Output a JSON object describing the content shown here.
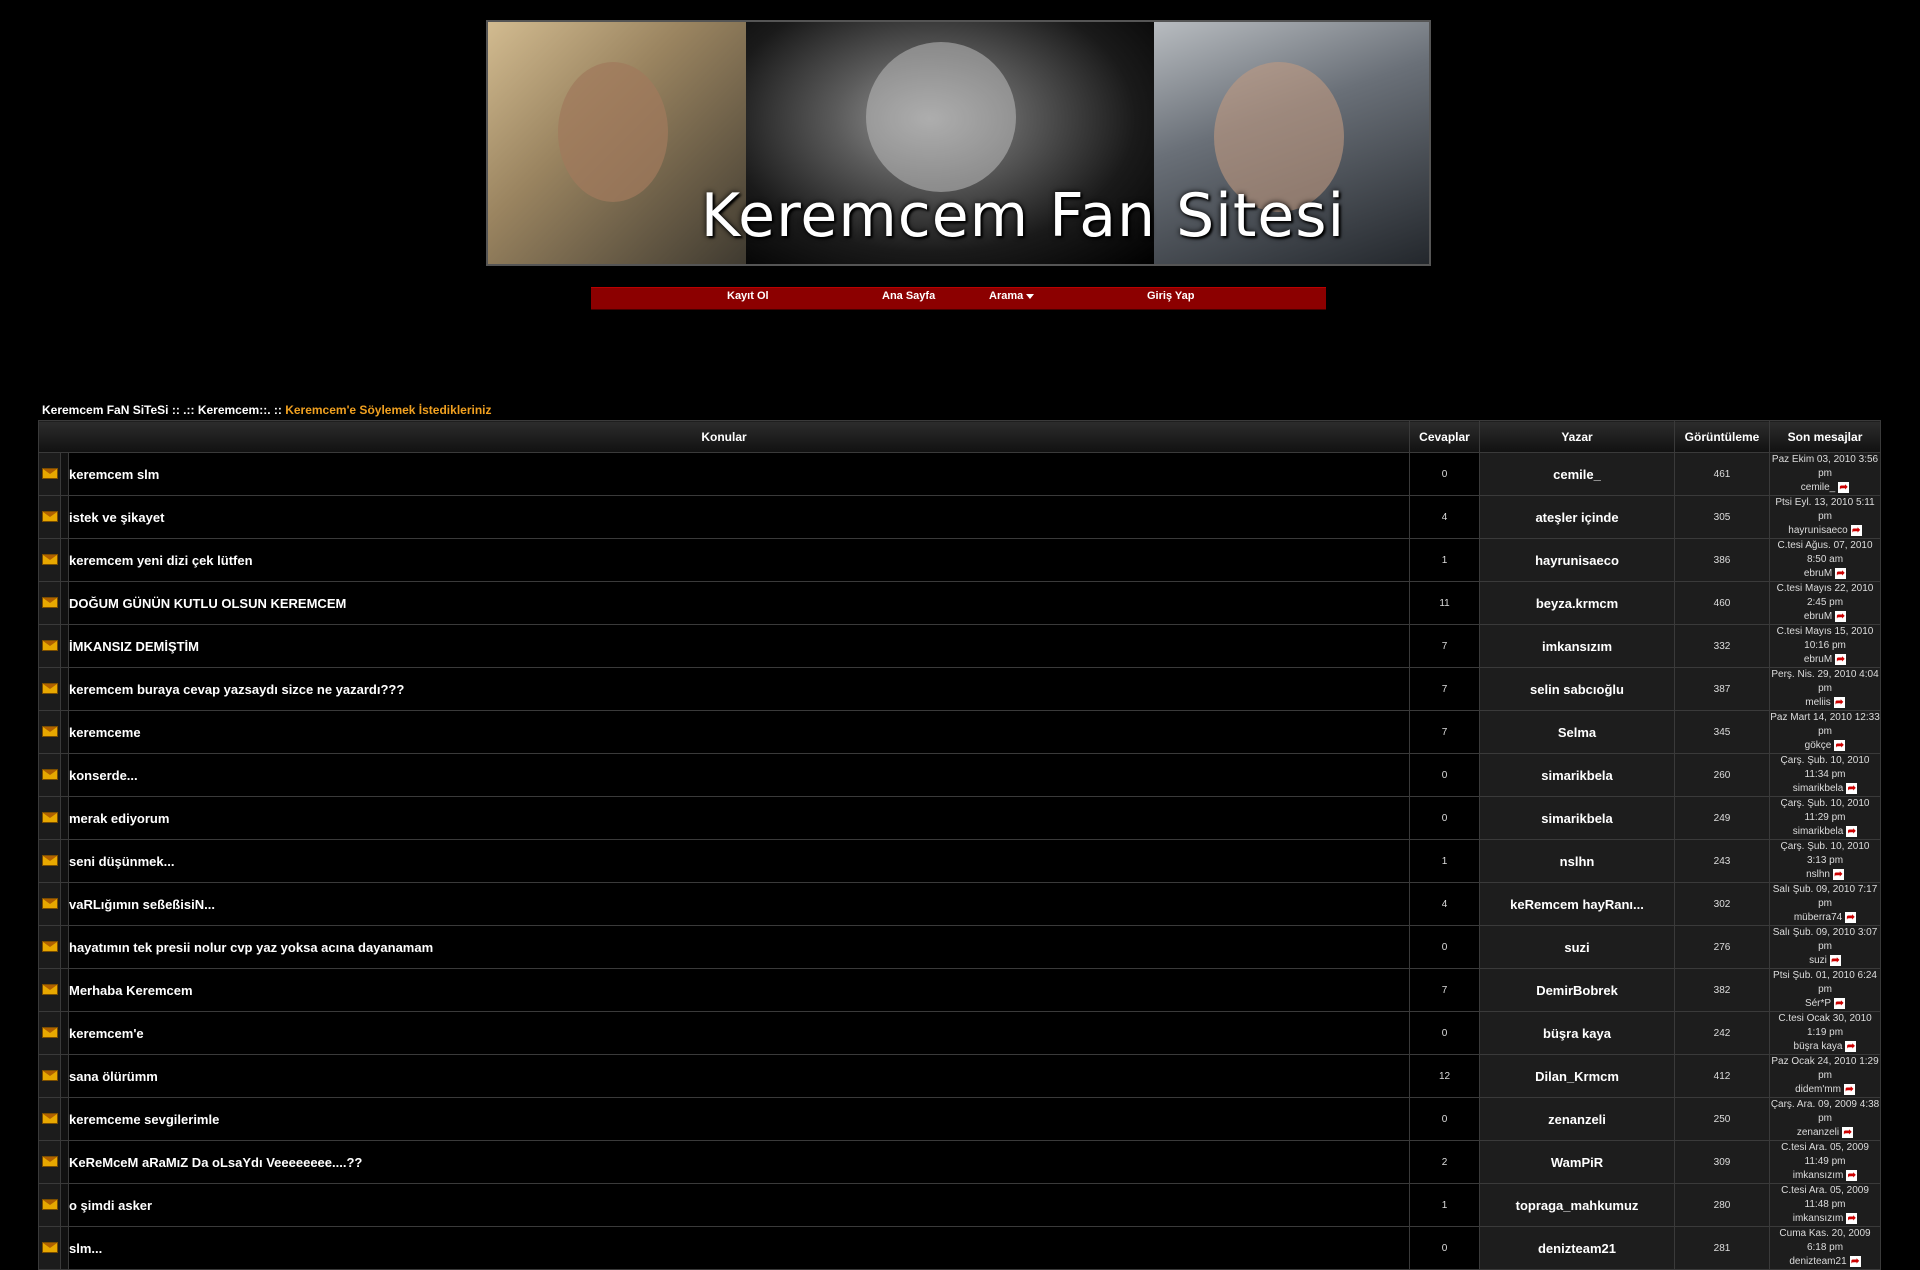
{
  "banner": {
    "title": "Keremcem Fan Sitesi"
  },
  "nav": {
    "register": "Kayıt Ol",
    "home": "Ana Sayfa",
    "search": "Arama",
    "login": "Giriş Yap"
  },
  "breadcrumb": {
    "site": "Keremcem FaN SiTeSi",
    "sep1": " :: ",
    "forum": ".:: Keremcem::.",
    "sep2": " :: ",
    "current": "Keremcem'e Söylemek İstedikleriniz"
  },
  "table": {
    "headers": {
      "topics": "Konular",
      "replies": "Cevaplar",
      "author": "Yazar",
      "views": "Görüntüleme",
      "last": "Son mesajlar"
    },
    "rows": [
      {
        "title": "keremcem slm",
        "replies": "0",
        "author": "cemile_",
        "views": "461",
        "last_date": "Paz Ekim 03, 2010 3:56 pm",
        "last_user": "cemile_"
      },
      {
        "title": "istek ve şikayet",
        "replies": "4",
        "author": "ateşler içinde",
        "views": "305",
        "last_date": "Ptsi Eyl. 13, 2010 5:11 pm",
        "last_user": "hayrunisaeco"
      },
      {
        "title": "keremcem yeni dizi çek lütfen",
        "replies": "1",
        "author": "hayrunisaeco",
        "views": "386",
        "last_date": "C.tesi Ağus. 07, 2010 8:50 am",
        "last_user": "ebruM"
      },
      {
        "title": "DOĞUM GÜNÜN KUTLU OLSUN KEREMCEM",
        "replies": "11",
        "author": "beyza.krmcm",
        "views": "460",
        "last_date": "C.tesi Mayıs 22, 2010 2:45 pm",
        "last_user": "ebruM"
      },
      {
        "title": "İMKANSIZ DEMİŞTİM",
        "replies": "7",
        "author": "imkansızım",
        "views": "332",
        "last_date": "C.tesi Mayıs 15, 2010 10:16 pm",
        "last_user": "ebruM"
      },
      {
        "title": "keremcem buraya cevap yazsaydı sizce ne yazardı???",
        "replies": "7",
        "author": "selin sabcıoğlu",
        "views": "387",
        "last_date": "Perş. Nis. 29, 2010 4:04 pm",
        "last_user": "meliis"
      },
      {
        "title": "keremceme",
        "replies": "7",
        "author": "Selma",
        "views": "345",
        "last_date": "Paz Mart 14, 2010 12:33 pm",
        "last_user": "gökçe"
      },
      {
        "title": "konserde...",
        "replies": "0",
        "author": "simarikbela",
        "views": "260",
        "last_date": "Çarş. Şub. 10, 2010 11:34 pm",
        "last_user": "simarikbela"
      },
      {
        "title": "merak ediyorum",
        "replies": "0",
        "author": "simarikbela",
        "views": "249",
        "last_date": "Çarş. Şub. 10, 2010 11:29 pm",
        "last_user": "simarikbela"
      },
      {
        "title": "seni düşünmek...",
        "replies": "1",
        "author": "nslhn",
        "views": "243",
        "last_date": "Çarş. Şub. 10, 2010 3:13 pm",
        "last_user": "nslhn"
      },
      {
        "title": "vaRLığımın seßeßisiN...",
        "replies": "4",
        "author": "keRemcem hayRanı...",
        "views": "302",
        "last_date": "Salı Şub. 09, 2010 7:17 pm",
        "last_user": "müberra74"
      },
      {
        "title": "hayatımın tek presii nolur cvp yaz yoksa acına dayanamam",
        "replies": "0",
        "author": "suzi",
        "views": "276",
        "last_date": "Salı Şub. 09, 2010 3:07 pm",
        "last_user": "suzi"
      },
      {
        "title": "Merhaba Keremcem",
        "replies": "7",
        "author": "DemirBobrek",
        "views": "382",
        "last_date": "Ptsi Şub. 01, 2010 6:24 pm",
        "last_user": "Sér*P"
      },
      {
        "title": "keremcem'e",
        "replies": "0",
        "author": "büşra kaya",
        "views": "242",
        "last_date": "C.tesi Ocak 30, 2010 1:19 pm",
        "last_user": "büşra kaya"
      },
      {
        "title": "sana ölürümm",
        "replies": "12",
        "author": "Dilan_Krmcm",
        "views": "412",
        "last_date": "Paz Ocak 24, 2010 1:29 pm",
        "last_user": "didem'mm"
      },
      {
        "title": "keremceme sevgilerimle",
        "replies": "0",
        "author": "zenanzeli",
        "views": "250",
        "last_date": "Çarş. Ara. 09, 2009 4:38 pm",
        "last_user": "zenanzeli"
      },
      {
        "title": "KeReMceM aRaMıZ Da oLsaYdı Veeeeeeee....??",
        "replies": "2",
        "author": "WamPiR",
        "views": "309",
        "last_date": "C.tesi Ara. 05, 2009 11:49 pm",
        "last_user": "imkansızım"
      },
      {
        "title": "o şimdi asker",
        "replies": "1",
        "author": "topraga_mahkumuz",
        "views": "280",
        "last_date": "C.tesi Ara. 05, 2009 11:48 pm",
        "last_user": "imkansızım"
      },
      {
        "title": "slm...",
        "replies": "0",
        "author": "denizteam21",
        "views": "281",
        "last_date": "Cuma Kas. 20, 2009 6:18 pm",
        "last_user": "denizteam21"
      }
    ]
  },
  "icons": {
    "topic": "envelope-icon",
    "goto": "goto-last-post-icon",
    "search_dropdown": "chevron-down-icon"
  },
  "colors": {
    "background": "#000000",
    "nav_bar": "#8c0000",
    "breadcrumb_current": "#f0a020"
  }
}
